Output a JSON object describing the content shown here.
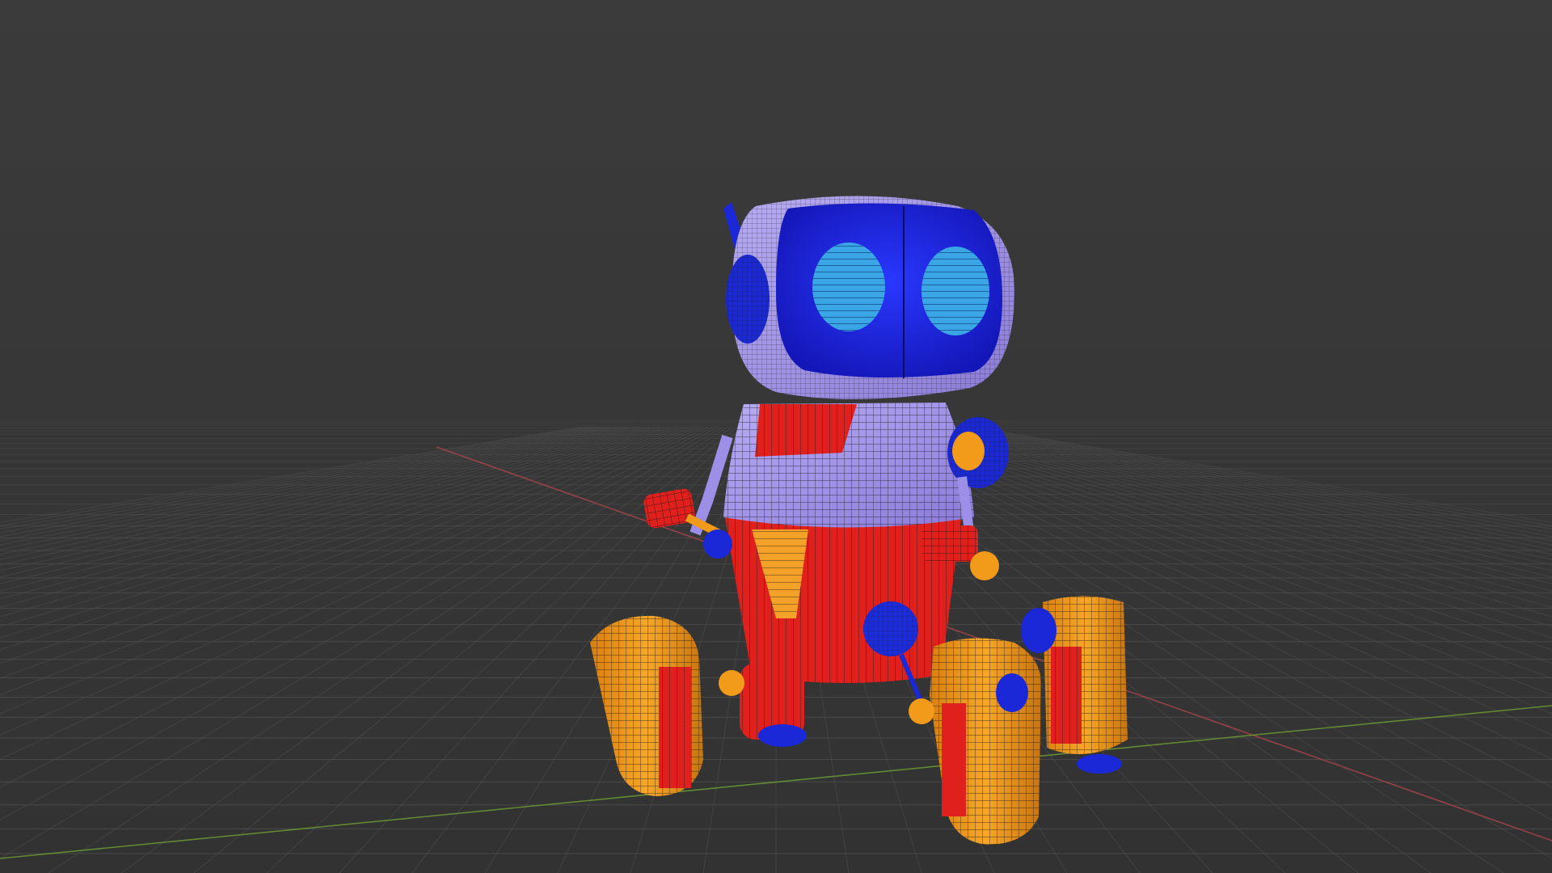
{
  "viewport": {
    "background_top": "#3a3a3a",
    "background_bottom": "#323232",
    "grid_color": "#4f4f4f",
    "x_axis_color": "#b1444e",
    "y_axis_color": "#6a9a32"
  },
  "model": {
    "name": "robot",
    "display_mode": "solid-with-wireframe-overlay",
    "colors": {
      "head_shell": "#9d8fe8",
      "screen": "#1a24e0",
      "eyes": "#3aa6e6",
      "body_top": "#9d8fe8",
      "body_bottom": "#e0201c",
      "accent": "#f29a1a",
      "joints": "#1a28d8",
      "wire": "#111111"
    }
  }
}
